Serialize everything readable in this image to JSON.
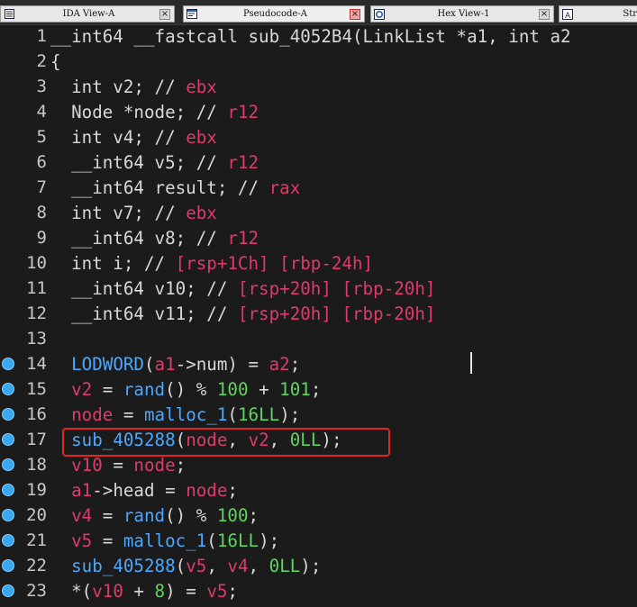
{
  "tabs": [
    {
      "label": "IDA View-A",
      "close": "×",
      "icon": "list-icon"
    },
    {
      "label": "Pseudocode-A",
      "close": "×",
      "icon": "code-icon"
    },
    {
      "label": "Hex View-1",
      "close": "×",
      "icon": "hex-icon"
    },
    {
      "label": "Str",
      "icon": "strings-icon"
    }
  ],
  "lines": [
    {
      "num": "1",
      "bp": false,
      "segs": [
        [
          "plain",
          "__int64 __fastcall sub_4052B4(LinkList *a1, int a2"
        ]
      ]
    },
    {
      "num": "2",
      "bp": false,
      "segs": [
        [
          "plain",
          "{"
        ]
      ]
    },
    {
      "num": "3",
      "bp": false,
      "segs": [
        [
          "plain",
          "  int v2; // "
        ],
        [
          "cmt",
          "ebx"
        ]
      ]
    },
    {
      "num": "4",
      "bp": false,
      "segs": [
        [
          "plain",
          "  Node *node; // "
        ],
        [
          "cmt",
          "r12"
        ]
      ]
    },
    {
      "num": "5",
      "bp": false,
      "segs": [
        [
          "plain",
          "  int v4; // "
        ],
        [
          "cmt",
          "ebx"
        ]
      ]
    },
    {
      "num": "6",
      "bp": false,
      "segs": [
        [
          "plain",
          "  __int64 v5; // "
        ],
        [
          "cmt",
          "r12"
        ]
      ]
    },
    {
      "num": "7",
      "bp": false,
      "segs": [
        [
          "plain",
          "  __int64 result; // "
        ],
        [
          "cmt",
          "rax"
        ]
      ]
    },
    {
      "num": "8",
      "bp": false,
      "segs": [
        [
          "plain",
          "  int v7; // "
        ],
        [
          "cmt",
          "ebx"
        ]
      ]
    },
    {
      "num": "9",
      "bp": false,
      "segs": [
        [
          "plain",
          "  __int64 v8; // "
        ],
        [
          "cmt",
          "r12"
        ]
      ]
    },
    {
      "num": "10",
      "bp": false,
      "segs": [
        [
          "plain",
          "  int i; // "
        ],
        [
          "cmt",
          "[rsp+1Ch] [rbp-24h]"
        ]
      ]
    },
    {
      "num": "11",
      "bp": false,
      "segs": [
        [
          "plain",
          "  __int64 v10; // "
        ],
        [
          "cmt",
          "[rsp+20h] [rbp-20h]"
        ]
      ]
    },
    {
      "num": "12",
      "bp": false,
      "segs": [
        [
          "plain",
          "  __int64 v11; // "
        ],
        [
          "cmt",
          "[rsp+20h] [rbp-20h]"
        ]
      ]
    },
    {
      "num": "13",
      "bp": false,
      "segs": [
        [
          "plain",
          ""
        ]
      ]
    },
    {
      "num": "14",
      "bp": true,
      "segs": [
        [
          "plain",
          "  "
        ],
        [
          "fn",
          "LODWORD"
        ],
        [
          "plain",
          "("
        ],
        [
          "var",
          "a1"
        ],
        [
          "plain",
          "->num) = "
        ],
        [
          "var",
          "a2"
        ],
        [
          "plain",
          ";"
        ]
      ]
    },
    {
      "num": "15",
      "bp": true,
      "segs": [
        [
          "plain",
          "  "
        ],
        [
          "var",
          "v2"
        ],
        [
          "plain",
          " = "
        ],
        [
          "fn",
          "rand"
        ],
        [
          "plain",
          "() % "
        ],
        [
          "num",
          "100"
        ],
        [
          "plain",
          " + "
        ],
        [
          "num",
          "101"
        ],
        [
          "plain",
          ";"
        ]
      ]
    },
    {
      "num": "16",
      "bp": true,
      "segs": [
        [
          "plain",
          "  "
        ],
        [
          "var",
          "node"
        ],
        [
          "plain",
          " = "
        ],
        [
          "fn",
          "malloc_1"
        ],
        [
          "plain",
          "("
        ],
        [
          "num",
          "16LL"
        ],
        [
          "plain",
          ");"
        ]
      ]
    },
    {
      "num": "17",
      "bp": true,
      "segs": [
        [
          "plain",
          "  "
        ],
        [
          "fn",
          "sub_405288"
        ],
        [
          "plain",
          "("
        ],
        [
          "var",
          "node"
        ],
        [
          "plain",
          ", "
        ],
        [
          "var",
          "v2"
        ],
        [
          "plain",
          ", "
        ],
        [
          "num",
          "0LL"
        ],
        [
          "plain",
          ");"
        ]
      ]
    },
    {
      "num": "18",
      "bp": true,
      "segs": [
        [
          "plain",
          "  "
        ],
        [
          "var",
          "v10"
        ],
        [
          "plain",
          " = "
        ],
        [
          "var",
          "node"
        ],
        [
          "plain",
          ";"
        ]
      ]
    },
    {
      "num": "19",
      "bp": true,
      "segs": [
        [
          "plain",
          "  "
        ],
        [
          "var",
          "a1"
        ],
        [
          "plain",
          "->head = "
        ],
        [
          "var",
          "node"
        ],
        [
          "plain",
          ";"
        ]
      ]
    },
    {
      "num": "20",
      "bp": true,
      "segs": [
        [
          "plain",
          "  "
        ],
        [
          "var",
          "v4"
        ],
        [
          "plain",
          " = "
        ],
        [
          "fn",
          "rand"
        ],
        [
          "plain",
          "() % "
        ],
        [
          "num",
          "100"
        ],
        [
          "plain",
          ";"
        ]
      ]
    },
    {
      "num": "21",
      "bp": true,
      "segs": [
        [
          "plain",
          "  "
        ],
        [
          "var",
          "v5"
        ],
        [
          "plain",
          " = "
        ],
        [
          "fn",
          "malloc_1"
        ],
        [
          "plain",
          "("
        ],
        [
          "num",
          "16LL"
        ],
        [
          "plain",
          ");"
        ]
      ]
    },
    {
      "num": "22",
      "bp": true,
      "segs": [
        [
          "plain",
          "  "
        ],
        [
          "fn",
          "sub_405288"
        ],
        [
          "plain",
          "("
        ],
        [
          "var",
          "v5"
        ],
        [
          "plain",
          ", "
        ],
        [
          "var",
          "v4"
        ],
        [
          "plain",
          ", "
        ],
        [
          "num",
          "0LL"
        ],
        [
          "plain",
          ");"
        ]
      ]
    },
    {
      "num": "23",
      "bp": true,
      "segs": [
        [
          "plain",
          "  *("
        ],
        [
          "var",
          "v10"
        ],
        [
          "plain",
          " + "
        ],
        [
          "num",
          "8"
        ],
        [
          "plain",
          ") = "
        ],
        [
          "var",
          "v5"
        ],
        [
          "plain",
          ";"
        ]
      ]
    }
  ],
  "colors": {
    "background": "#1b1b1b",
    "comment": "#e03a6a",
    "function": "#4aa8ff",
    "number": "#5fd35f",
    "highlight_box": "#e02626",
    "breakpoint": "#3aa8f0"
  }
}
